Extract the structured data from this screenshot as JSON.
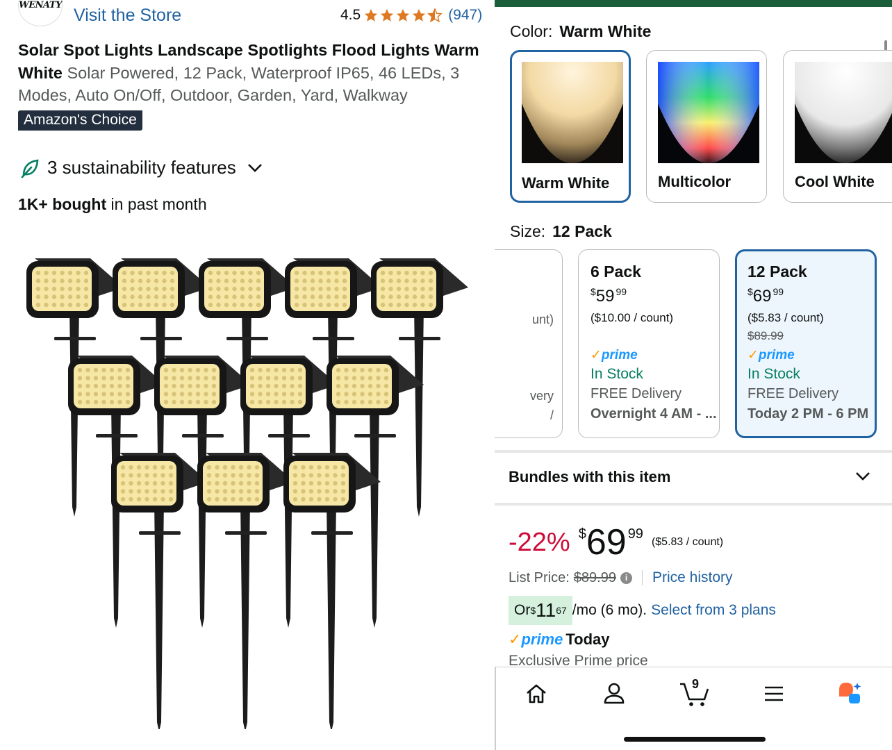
{
  "left": {
    "brand_logo_text": "WENATY",
    "visit_store": "Visit the Store",
    "rating": "4.5",
    "rating_count": "(947)",
    "title_bold": "Solar Spot Lights Landscape Spotlights Flood Lights Warm White",
    "title_rest": " Solar Powered, 12 Pack, Waterproof IP65, 46 LEDs, 3 Modes, Auto On/Off, Outdoor, Garden, Yard, Walkway",
    "badge": "Amazon's Choice",
    "sustainability": "3 sustainability features",
    "bought_bold": "1K+ bought",
    "bought_rest": " in past month",
    "stars_filled": 4.5
  },
  "right": {
    "color_label": "Color:",
    "color_selected": "Warm White",
    "colors": [
      {
        "label": "Warm White"
      },
      {
        "label": "Multicolor"
      },
      {
        "label": "Cool White"
      }
    ],
    "size_label": "Size:",
    "size_selected": "12 Pack",
    "partial_card": {
      "unit_tail": "unt)",
      "delivery_tail": "very",
      "extra_tail": "/"
    },
    "sizes": [
      {
        "name": "6 Pack",
        "currency": "$",
        "whole": "59",
        "frac": "99",
        "unit": "($10.00 / count)",
        "list": "",
        "prime": "prime",
        "stock": "In Stock",
        "free": "FREE Delivery",
        "delivery": "Overnight 4 AM - ..."
      },
      {
        "name": "12 Pack",
        "currency": "$",
        "whole": "69",
        "frac": "99",
        "unit": "($5.83 / count)",
        "list": "$89.99",
        "prime": "prime",
        "stock": "In Stock",
        "free": "FREE Delivery",
        "delivery": "Today 2 PM - 6 PM"
      }
    ],
    "bundles": "Bundles with this item",
    "discount": "-22%",
    "price_currency": "$",
    "price_whole": "69",
    "price_frac": "99",
    "price_unit": "($5.83 / count)",
    "list_price_label": "List Price:",
    "list_price": "$89.99",
    "price_history": "Price history",
    "installment_or": "Or ",
    "installment_currency": "$",
    "installment_whole": "11",
    "installment_frac": "67",
    "installment_tail": "/mo (6 mo).",
    "installment_plans": "Select from 3 plans",
    "prime_word": "prime",
    "prime_today": "Today",
    "exclusive": "Exclusive Prime price",
    "cart_count": "9",
    "nav_icons": [
      "home-icon",
      "account-icon",
      "cart-icon",
      "menu-icon",
      "rufus-icon"
    ],
    "colors_hex": {
      "link": "#2162a1",
      "discount": "#cc0c39",
      "prime": "#1a98ff",
      "stock": "#067d62",
      "selected_border": "#2162a1"
    }
  }
}
